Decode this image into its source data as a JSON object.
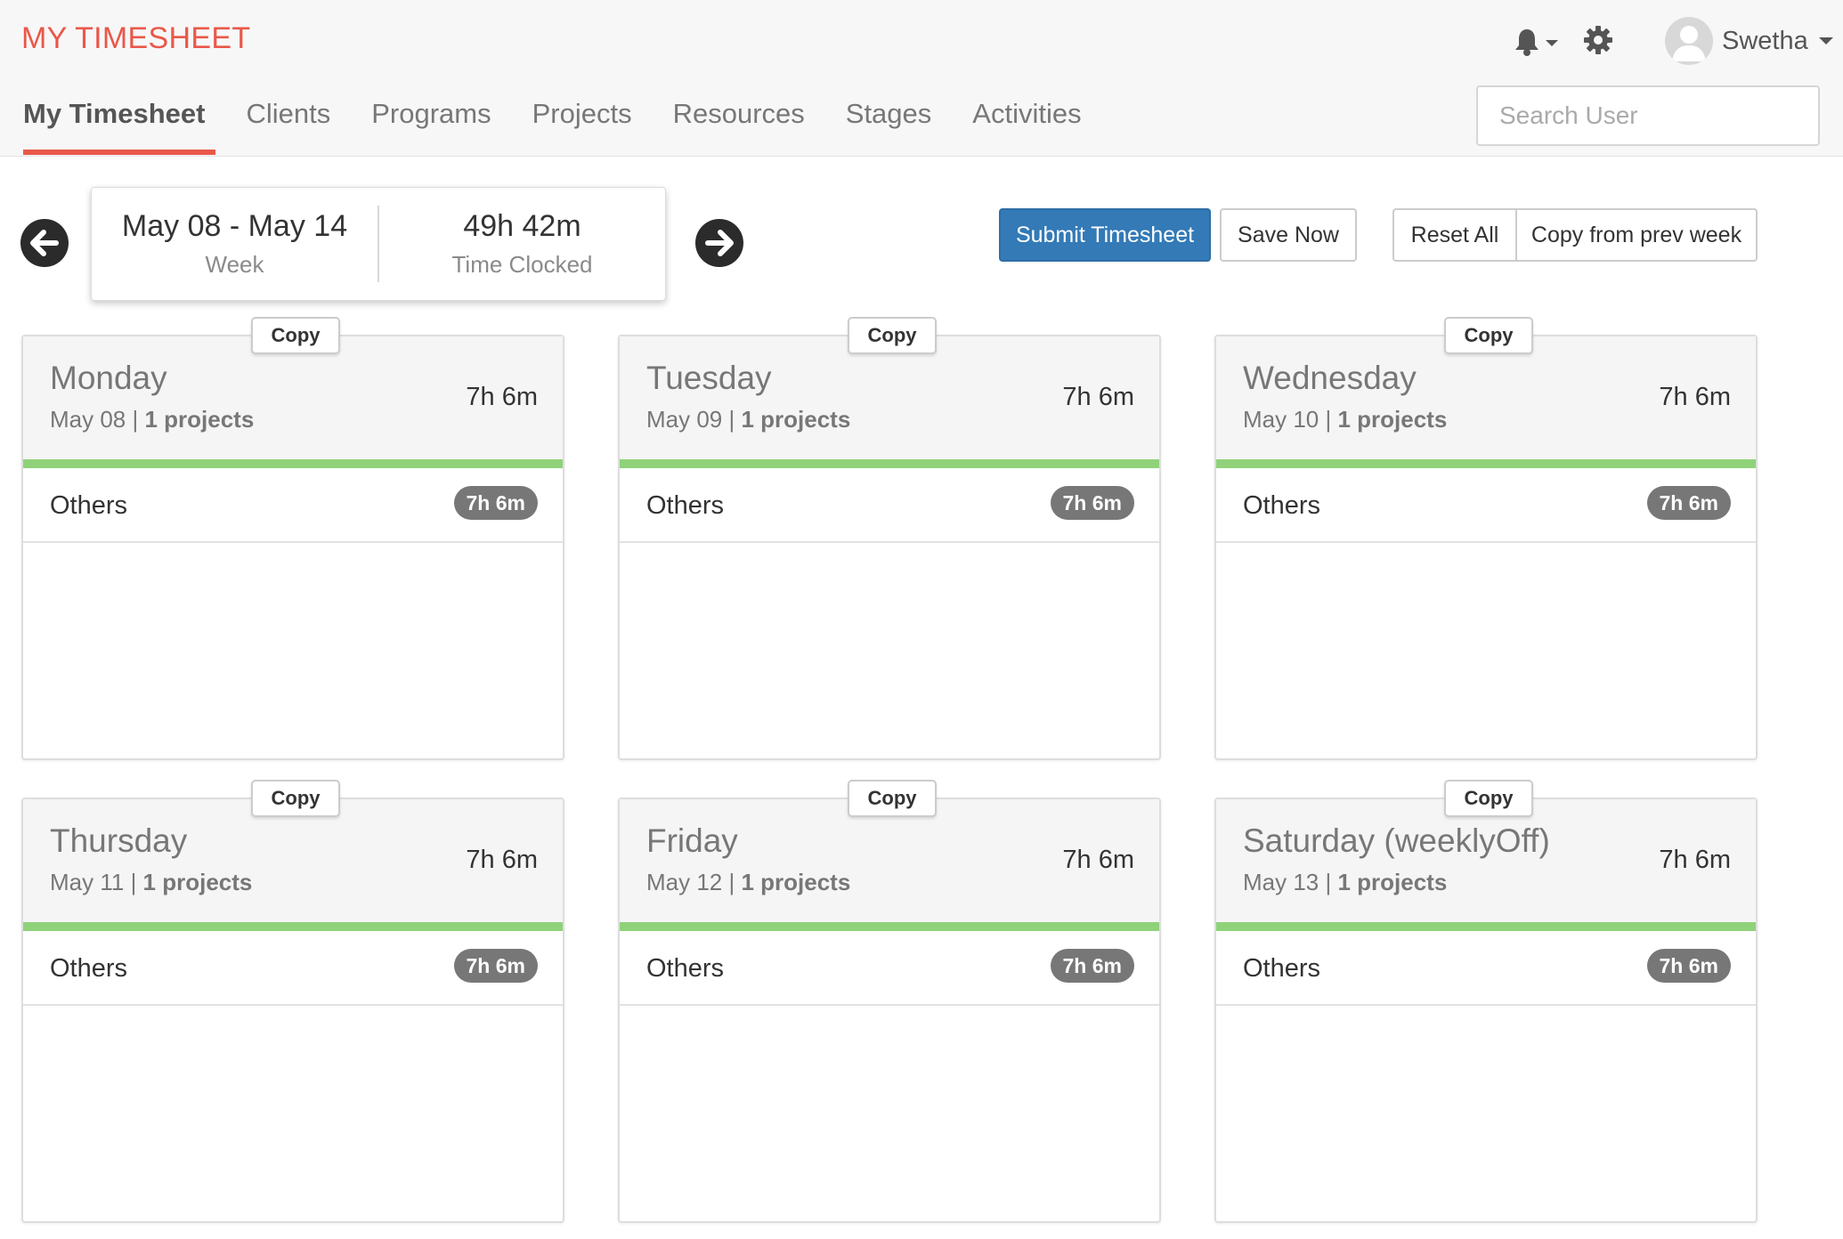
{
  "app": {
    "brand": "MY TIMESHEET"
  },
  "header": {
    "user_name": "Swetha",
    "search_placeholder": "Search User"
  },
  "nav": {
    "items": [
      {
        "label": "My Timesheet",
        "active": true
      },
      {
        "label": "Clients",
        "active": false
      },
      {
        "label": "Programs",
        "active": false
      },
      {
        "label": "Projects",
        "active": false
      },
      {
        "label": "Resources",
        "active": false
      },
      {
        "label": "Stages",
        "active": false
      },
      {
        "label": "Activities",
        "active": false
      }
    ]
  },
  "week": {
    "range": "May 08 - May 14",
    "range_label": "Week",
    "clocked": "49h 42m",
    "clocked_label": "Time Clocked"
  },
  "actions": {
    "submit": "Submit Timesheet",
    "save": "Save Now",
    "reset": "Reset All",
    "copy_prev": "Copy from prev week"
  },
  "days": [
    {
      "copy_label": "Copy",
      "name": "Monday",
      "date": "May 08",
      "projects": "1 projects",
      "total": "7h 6m",
      "progress": 1.0,
      "entries": [
        {
          "name": "Others",
          "time": "7h 6m"
        }
      ]
    },
    {
      "copy_label": "Copy",
      "name": "Tuesday",
      "date": "May 09",
      "projects": "1 projects",
      "total": "7h 6m",
      "progress": 1.0,
      "entries": [
        {
          "name": "Others",
          "time": "7h 6m"
        }
      ]
    },
    {
      "copy_label": "Copy",
      "name": "Wednesday",
      "date": "May 10",
      "projects": "1 projects",
      "total": "7h 6m",
      "progress": 1.0,
      "entries": [
        {
          "name": "Others",
          "time": "7h 6m"
        }
      ]
    },
    {
      "copy_label": "Copy",
      "name": "Thursday",
      "date": "May 11",
      "projects": "1 projects",
      "total": "7h 6m",
      "progress": 1.0,
      "entries": [
        {
          "name": "Others",
          "time": "7h 6m"
        }
      ]
    },
    {
      "copy_label": "Copy",
      "name": "Friday",
      "date": "May 12",
      "projects": "1 projects",
      "total": "7h 6m",
      "progress": 1.0,
      "entries": [
        {
          "name": "Others",
          "time": "7h 6m"
        }
      ]
    },
    {
      "copy_label": "Copy",
      "name": "Saturday (weeklyOff)",
      "date": "May 13",
      "projects": "1 projects",
      "total": "7h 6m",
      "progress": 1.0,
      "entries": [
        {
          "name": "Others",
          "time": "7h 6m"
        }
      ]
    }
  ],
  "colors": {
    "brand": "#e9584a",
    "primary": "#337ab7",
    "progress": "#8fd27a",
    "badge": "#777777"
  }
}
